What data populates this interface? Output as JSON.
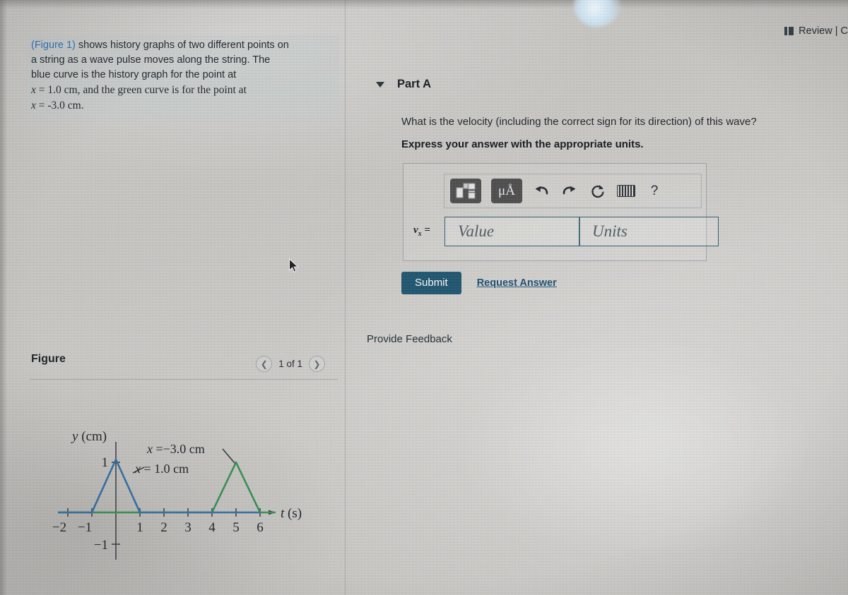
{
  "header": {
    "review_label": "Review | C",
    "review_icon": "book-icon"
  },
  "left_panel": {
    "problem": {
      "figure_link": "(Figure 1)",
      "line1_rest": " shows history graphs of two different points on",
      "line2": "a string as a wave pulse moves along the string. The",
      "line3": "blue curve is the history graph for the point at",
      "line4_math": "x",
      "line4_rest": " = 1.0 cm, and the green curve is for the point at",
      "line5_math": "x",
      "line5_rest": " = -3.0 cm."
    },
    "figure": {
      "title": "Figure",
      "pager": {
        "prev_icon": "chevron-left-icon",
        "next_icon": "chevron-right-icon",
        "count_label": "1 of 1"
      }
    }
  },
  "chart_data": {
    "type": "line",
    "title": "",
    "xlabel": "t (s)",
    "ylabel": "y (cm)",
    "xlim": [
      -2.6,
      6.9
    ],
    "ylim": [
      -1.4,
      1.35
    ],
    "xticks": [
      -2,
      -1,
      1,
      2,
      3,
      4,
      5,
      6
    ],
    "xtick_labels": [
      "−2",
      "−1",
      "1",
      "2",
      "3",
      "4",
      "5",
      "6"
    ],
    "yticks": [
      1,
      -1
    ],
    "ytick_labels": [
      "1",
      "−1"
    ],
    "grid": false,
    "legend": "inline-annotations",
    "series": [
      {
        "name": "x = 1.0 cm",
        "color": "#2f6ca3",
        "annotation": "x = 1.0 cm",
        "x": [
          -2.5,
          -1,
          0,
          1,
          6.8
        ],
        "y": [
          0,
          0,
          1,
          0,
          0
        ]
      },
      {
        "name": "x = -3.0 cm",
        "color": "#2f8f4e",
        "annotation": "x =−3.0 cm",
        "x": [
          -2.5,
          4,
          5,
          6,
          6.8
        ],
        "y": [
          0,
          0,
          1,
          0,
          0
        ]
      }
    ]
  },
  "right_panel": {
    "part": {
      "caret_icon": "caret-down-icon",
      "title": "Part A"
    },
    "question": "What is the velocity (including the correct sign for its direction) of this wave?",
    "express": "Express your answer with the appropriate units.",
    "toolbar": {
      "template_button": "template-icon",
      "units_button": "μÅ",
      "undo_icon": "undo-icon",
      "redo_icon": "redo-icon",
      "reset_icon": "reset-icon",
      "keyboard_icon": "keyboard-icon",
      "help_label": "?"
    },
    "answer": {
      "variable_label": "v",
      "variable_sub": "x",
      "variable_eq": " =",
      "value_placeholder": "Value",
      "units_placeholder": "Units",
      "value": "",
      "units": ""
    },
    "submit_label": "Submit",
    "request_answer_label": "Request Answer",
    "feedback_label": "Provide Feedback"
  },
  "colors": {
    "submit_bg": "#1d5570",
    "link": "#1a4f73",
    "figure_link": "#2a6fbd",
    "blue_curve": "#2f6ca3",
    "green_curve": "#2f8f4e",
    "field_border": "#2e5f72"
  }
}
